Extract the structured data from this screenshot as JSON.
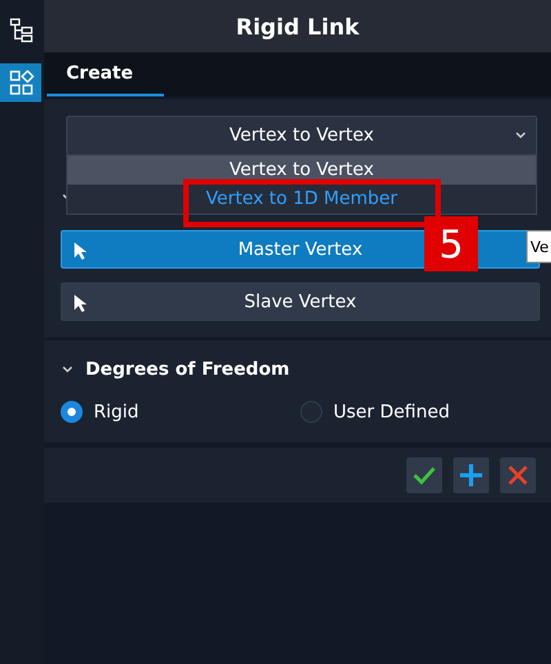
{
  "window": {
    "title": "Rigid Link"
  },
  "rail": [
    {
      "kind": "tree",
      "selected": false
    },
    {
      "kind": "components",
      "selected": true
    }
  ],
  "tabs": [
    {
      "label": "Create",
      "selected": true
    }
  ],
  "link_type": {
    "value": "Vertex to Vertex",
    "expanded": true,
    "options": [
      {
        "label": "Vertex to Vertex",
        "hovered": false,
        "selected": true
      },
      {
        "label": "Vertex to 1D Member",
        "hovered": true,
        "selected": false
      }
    ]
  },
  "vertex_section": {
    "expanded": true,
    "buttons": [
      {
        "label": "Master Vertex",
        "active": true
      },
      {
        "label": "Slave Vertex",
        "active": false
      }
    ]
  },
  "dof_section": {
    "title": "Degrees of Freedom",
    "expanded": true,
    "options": [
      {
        "label": "Rigid",
        "selected": true
      },
      {
        "label": "User Defined",
        "selected": false
      }
    ]
  },
  "actions": [
    {
      "kind": "apply"
    },
    {
      "kind": "add"
    },
    {
      "kind": "cancel"
    }
  ],
  "annotation": {
    "step": "5"
  },
  "tooltip": {
    "text": "Ve"
  }
}
